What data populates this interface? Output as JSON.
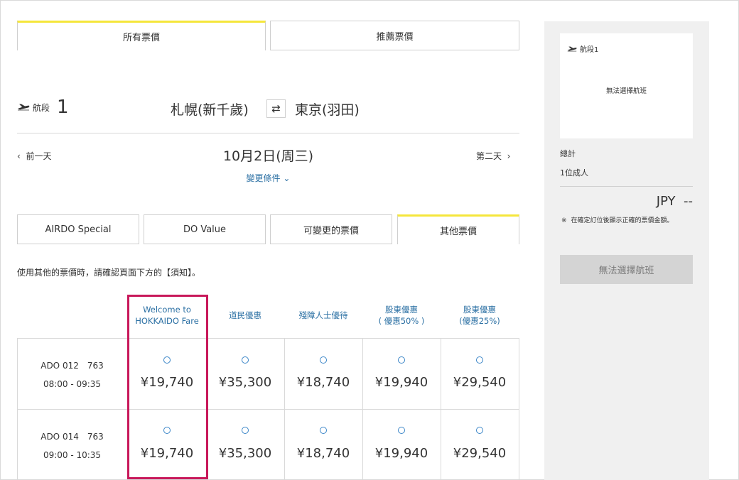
{
  "fare_type_tabs": {
    "all": "所有票價",
    "recommended": "推薦票價"
  },
  "segment": {
    "label": "航段",
    "number": "1",
    "origin": "札幌(新千歲)",
    "swap_glyph": "⇄",
    "destination": "東京(羽田)"
  },
  "date_nav": {
    "prev": "前一天",
    "prev_glyph": "‹",
    "date": "10月2日(周三)",
    "next": "第二天",
    "next_glyph": "›",
    "change_conditions": "變更條件",
    "change_glyph": "⌄"
  },
  "category_tabs": [
    "AIRDO Special",
    "DO Value",
    "可變更的票價",
    "其他票價"
  ],
  "notice": "使用其他的票價時，請確認頁面下方的【須知】。",
  "columns": [
    {
      "line1": "Welcome to",
      "line2": "HOKKAIDO Fare"
    },
    {
      "line1": "道民優惠",
      "line2": ""
    },
    {
      "line1": "殘障人士優待",
      "line2": ""
    },
    {
      "line1": "股東優惠",
      "line2": "( 優惠50% )"
    },
    {
      "line1": "股東優惠",
      "line2": "(優惠25%)"
    }
  ],
  "flights": [
    {
      "flight": "ADO 012　763",
      "time": "08:00 - 09:35",
      "prices": [
        "¥19,740",
        "¥35,300",
        "¥18,740",
        "¥19,940",
        "¥29,540"
      ]
    },
    {
      "flight": "ADO 014　763",
      "time": "09:00 - 10:35",
      "prices": [
        "¥19,740",
        "¥35,300",
        "¥18,740",
        "¥19,940",
        "¥29,540"
      ]
    }
  ],
  "highlight_color": "#c8185a",
  "accent_yellow": "#f5e63b",
  "sidebar": {
    "segment_label": "航段1",
    "no_flight_selected": "無法選擇航班",
    "total_label": "總計",
    "passengers": "1位成人",
    "currency": "JPY",
    "amount": "--",
    "note_mark": "※",
    "note_text": "在確定訂位後顯示正確的票價金額。",
    "button": "無法選擇航班"
  },
  "icons": {
    "plane": "airplane-icon"
  }
}
